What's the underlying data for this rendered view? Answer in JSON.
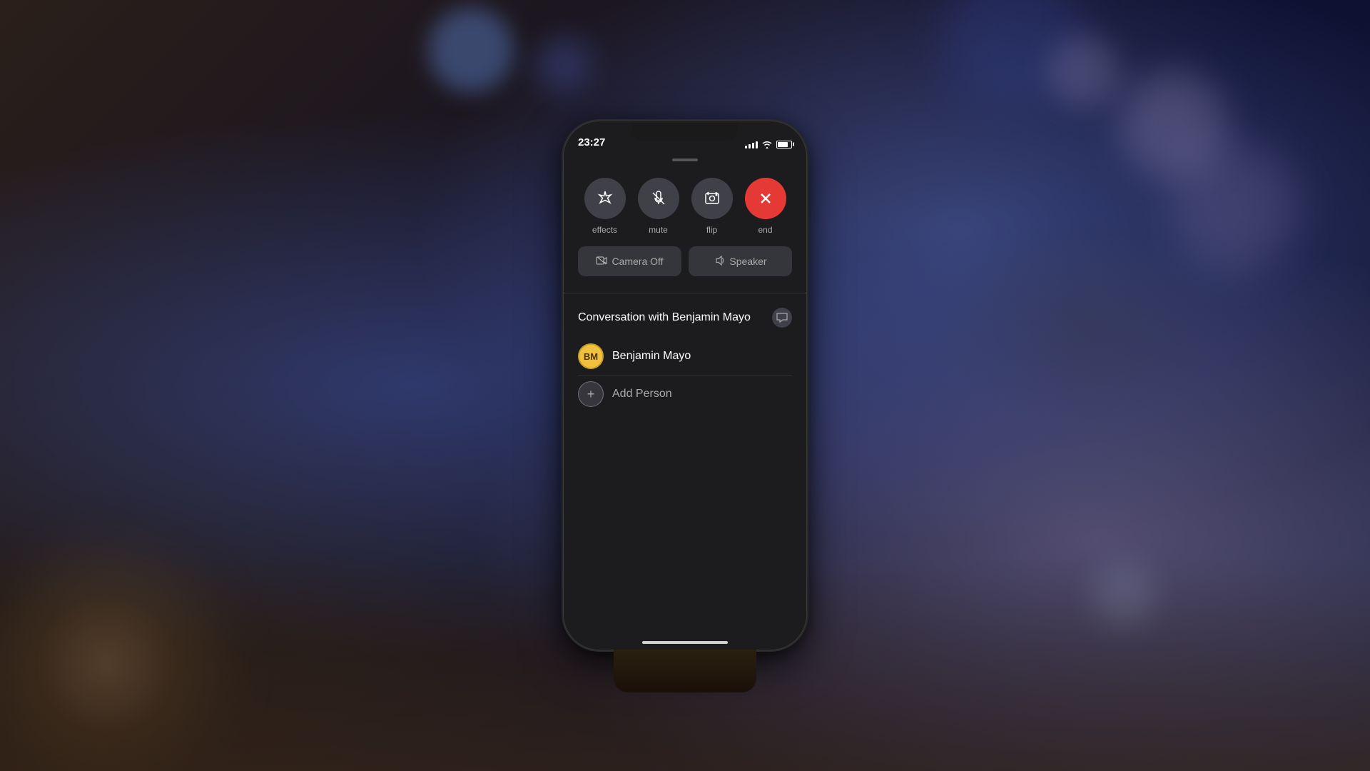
{
  "background": {
    "description": "Blurred bokeh background with blue/purple tones"
  },
  "phone": {
    "status_bar": {
      "time": "23:27",
      "signal_label": "signal",
      "wifi_label": "wifi",
      "battery_label": "battery"
    },
    "controls": {
      "buttons": [
        {
          "id": "effects",
          "label": "effects",
          "icon": "✦",
          "type": "normal"
        },
        {
          "id": "mute",
          "label": "mute",
          "icon": "🎙",
          "type": "normal"
        },
        {
          "id": "flip",
          "label": "flip",
          "icon": "📷",
          "type": "normal"
        },
        {
          "id": "end",
          "label": "end",
          "icon": "✕",
          "type": "end"
        }
      ],
      "bottom_buttons": [
        {
          "id": "camera-off",
          "icon": "📷",
          "label": "Camera Off"
        },
        {
          "id": "speaker",
          "icon": "🔊",
          "label": "Speaker"
        }
      ]
    },
    "conversation": {
      "title": "Conversation with Benjamin Mayo",
      "message_icon": "💬",
      "contacts": [
        {
          "id": "benjamin-mayo",
          "initials": "BM",
          "name": "Benjamin Mayo"
        }
      ],
      "add_person": {
        "icon": "+",
        "label": "Add Person"
      }
    },
    "home_indicator": true
  }
}
